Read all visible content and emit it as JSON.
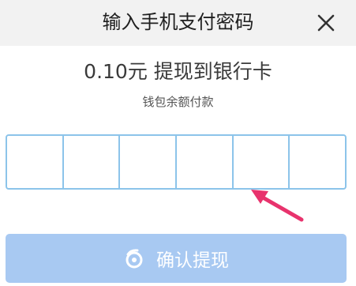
{
  "header": {
    "title": "输入手机支付密码",
    "close_icon": "close-icon"
  },
  "transfer": {
    "amount": "0.10元",
    "action": "提现到银行卡",
    "source": "钱包余额付款"
  },
  "pin": {
    "length": 6,
    "border_color": "#8cc4ea"
  },
  "confirm": {
    "label": "确认提现",
    "icon": "wallet-logo-icon",
    "background": "#a8c9f2"
  },
  "annotation": {
    "arrow_color": "#e8336d"
  }
}
